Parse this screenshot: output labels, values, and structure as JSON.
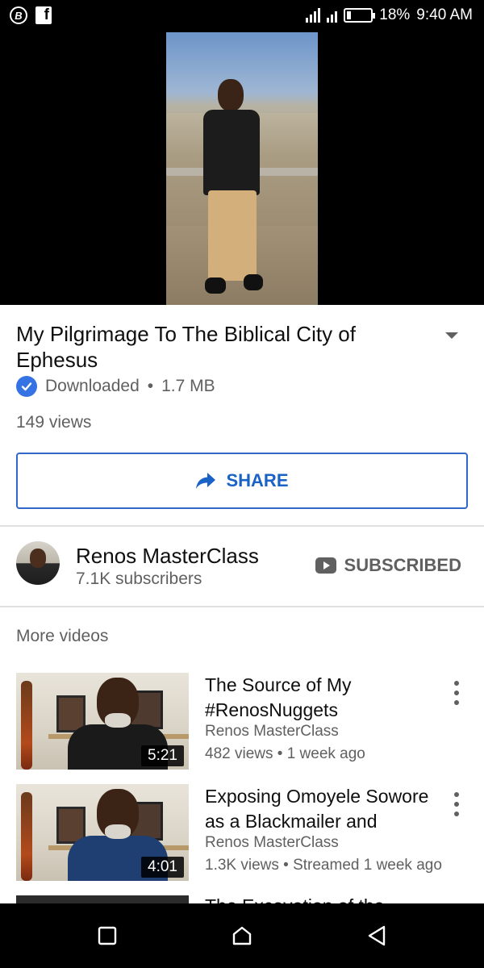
{
  "status_bar": {
    "left_badge": "B",
    "left_app": "f",
    "battery": "18%",
    "time": "9:40 AM",
    "battery_level": 0.18
  },
  "video": {
    "title": "My Pilgrimage To The Biblical City of Ephesus",
    "downloaded_label": "Downloaded",
    "size": "1.7 MB",
    "views": "149 views",
    "share_label": "SHARE"
  },
  "channel": {
    "name": "Renos MasterClass",
    "subscribers": "7.1K subscribers",
    "subscribed_label": "SUBSCRIBED"
  },
  "more_videos": {
    "label": "More videos",
    "items": [
      {
        "title": "The Source of My #RenosNuggets",
        "channel": "Renos MasterClass",
        "meta": "482 views • 1 week ago",
        "duration": "5:21"
      },
      {
        "title": "Exposing Omoyele Sowore as a Blackmailer and",
        "channel": "Renos MasterClass",
        "meta": "1.3K views • Streamed 1 week ago",
        "duration": "4:01"
      },
      {
        "title": "The Excavation of the"
      }
    ]
  },
  "colors": {
    "accent_blue": "#1a62c6",
    "secondary_text": "#606060",
    "check_badge": "#3572e3"
  },
  "icons": {
    "share": "share-arrow-icon",
    "check": "check-circle-icon",
    "expand": "caret-down-icon",
    "subscribed": "youtube-icon",
    "more": "more-vertical-icon",
    "nav": [
      "square-recents-icon",
      "home-icon",
      "back-triangle-icon"
    ]
  }
}
